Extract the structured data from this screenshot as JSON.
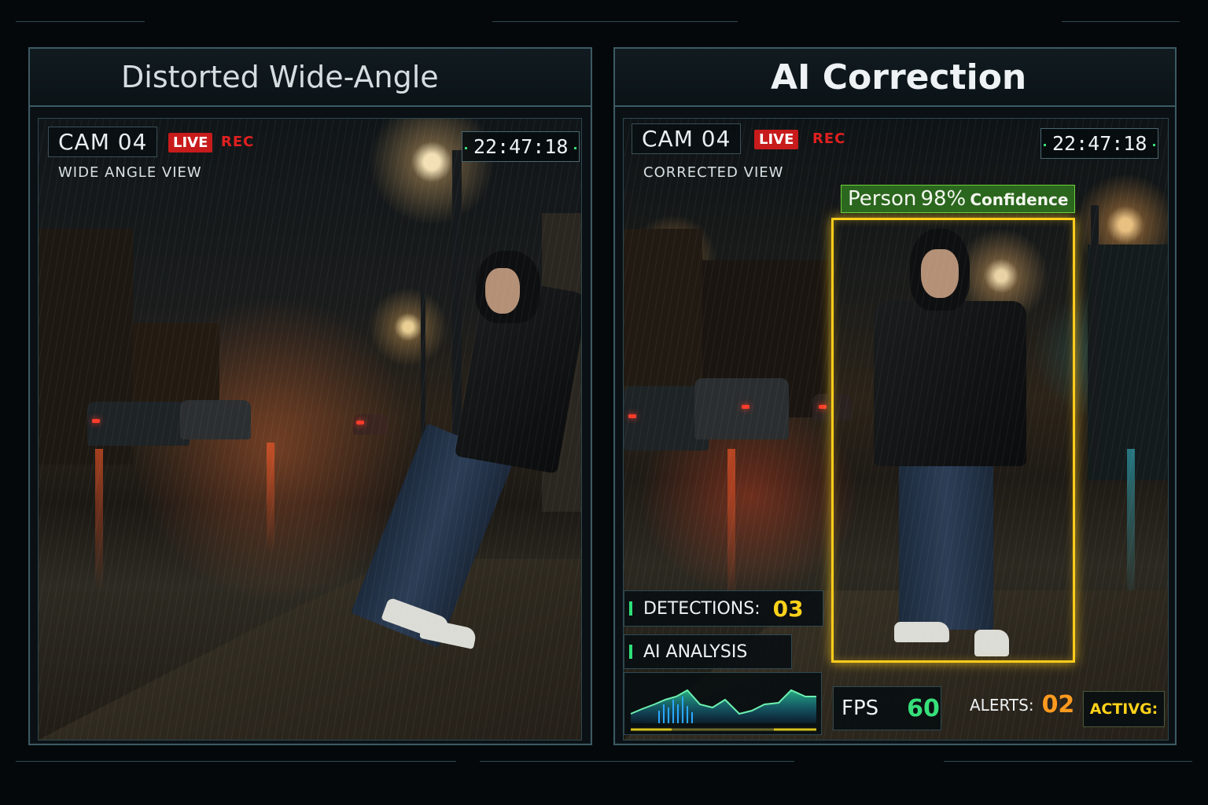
{
  "left_panel": {
    "title": "Distorted Wide-Angle",
    "camera": "CAM 04",
    "live": "LIVE",
    "rec": "REC",
    "view": "WIDE ANGLE VIEW",
    "time": "22:47:18"
  },
  "right_panel": {
    "title": "AI Correction",
    "camera": "CAM 04",
    "live": "LIVE",
    "rec": "REC",
    "view": "CORRECTED VIEW",
    "time": "22:47:18",
    "detection_label": {
      "class": "Person",
      "percent": "98%",
      "suffix": "Confidence"
    },
    "detections": {
      "label": "DETECTIONS:",
      "value": "03"
    },
    "ai_analysis": {
      "label": "AI ANALYSIS"
    },
    "fps": {
      "label": "FPS",
      "value": "60"
    },
    "alerts": {
      "label": "ALERTS:",
      "value": "02"
    },
    "status": "ACTIVG:"
  },
  "colors": {
    "live": "#c81b1b",
    "rec": "#e02020",
    "detection_box": "#ffcc1a",
    "confidence_tag": "#2e6e20",
    "value_yellow": "#ffd21a",
    "value_green": "#37e07a",
    "value_orange": "#ff9a1f",
    "graph": "#2fe0a0"
  },
  "icons": [
    "status-bar-icon",
    "analysis-graph-icon"
  ]
}
